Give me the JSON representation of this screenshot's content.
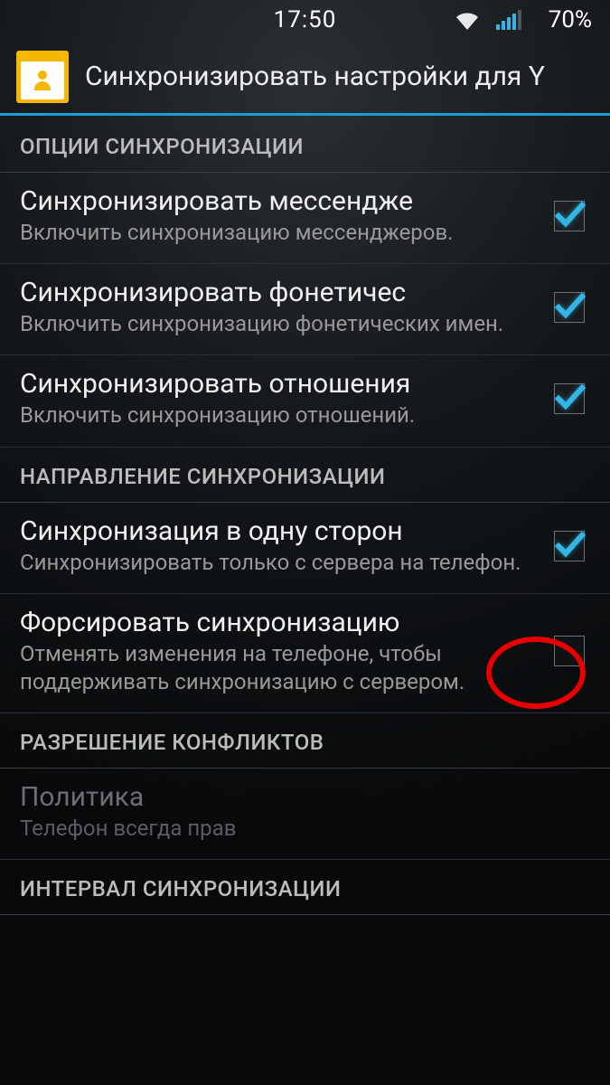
{
  "status": {
    "time": "17:50",
    "battery": "70%"
  },
  "header": {
    "title": "Синхронизировать настройки для Y"
  },
  "sections": {
    "s0": {
      "label": "ОПЦИИ СИНХРОНИЗАЦИИ"
    },
    "s1": {
      "label": "НАПРАВЛЕНИЕ СИНХРОНИЗАЦИИ"
    },
    "s2": {
      "label": "РАЗРЕШЕНИЕ КОНФЛИКТОВ"
    },
    "s3": {
      "label": "ИНТЕРВАЛ СИНХРОНИЗАЦИИ"
    }
  },
  "items": {
    "messengers": {
      "title": "Синхронизировать мессендже",
      "sub": "Включить синхронизацию мессенджеров.",
      "checked": true
    },
    "phonetic": {
      "title": "Синхронизировать фонетичес",
      "sub": "Включить синхронизацию фонетических имен.",
      "checked": true
    },
    "relations": {
      "title": "Синхронизировать отношения",
      "sub": "Включить синхронизацию отношений.",
      "checked": true
    },
    "oneway": {
      "title": "Синхронизация в одну сторон",
      "sub": "Синхронизировать только с сервера на телефон.",
      "checked": true
    },
    "force": {
      "title": "Форсировать синхронизацию",
      "sub": "Отменять изменения на телефоне, чтобы поддерживать синхронизацию с сервером.",
      "checked": false
    },
    "policy": {
      "title": "Политика",
      "sub": "Телефон всегда прав"
    }
  }
}
